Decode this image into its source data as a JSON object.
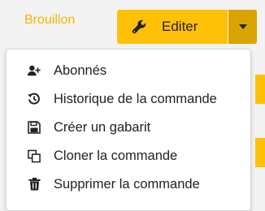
{
  "header": {
    "status_label": "Brouillon",
    "edit_button_label": "Editer"
  },
  "colors": {
    "accent": "#ffc107",
    "accent_dark": "#d9a400",
    "status_text": "#f5b400"
  },
  "menu": {
    "items": [
      {
        "label": "Abonnés",
        "icon": "user-plus-icon"
      },
      {
        "label": "Historique de la commande",
        "icon": "history-icon"
      },
      {
        "label": "Créer un gabarit",
        "icon": "save-icon"
      },
      {
        "label": "Cloner la commande",
        "icon": "clone-icon"
      },
      {
        "label": "Supprimer la commande",
        "icon": "trash-icon"
      }
    ]
  }
}
